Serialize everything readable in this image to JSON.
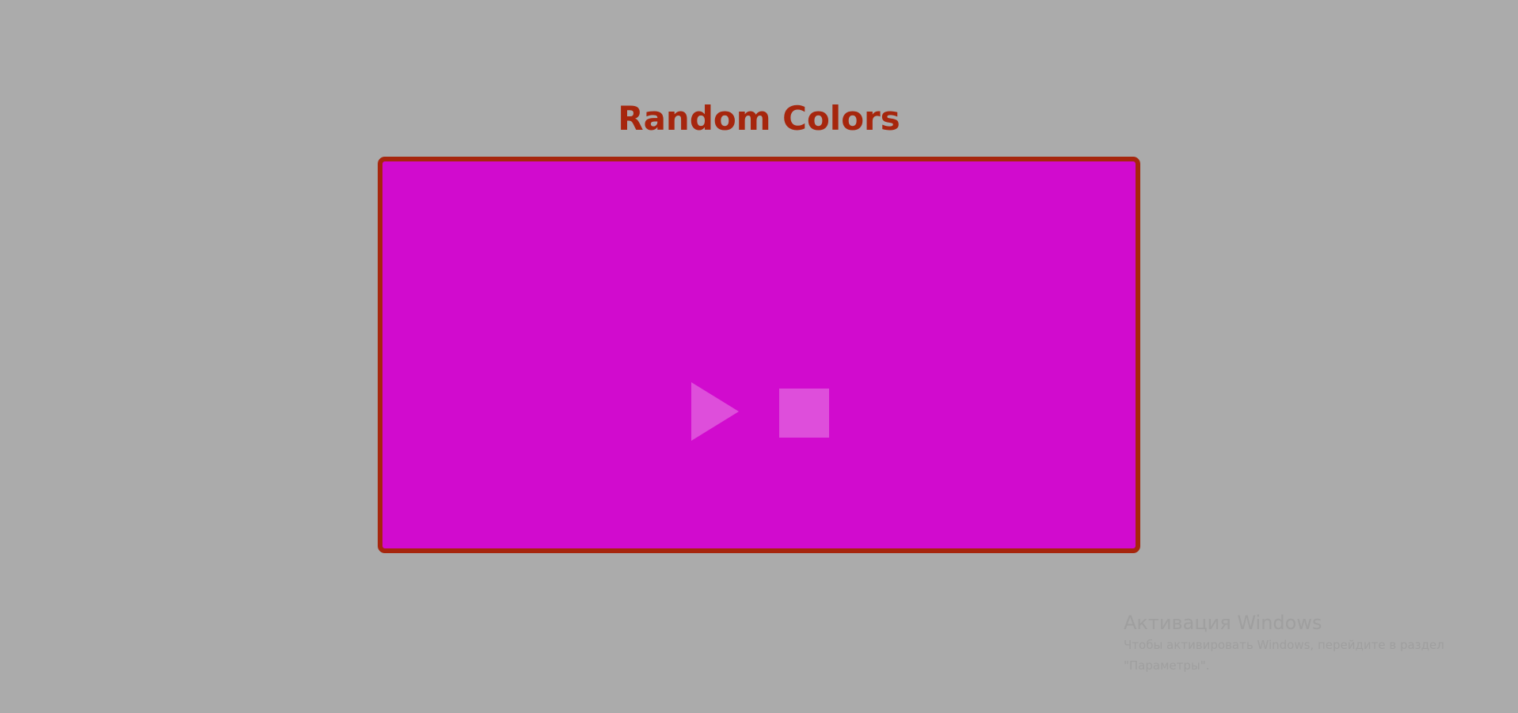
{
  "page": {
    "title": "Random Colors"
  },
  "panel": {
    "current_color": "#d10bce",
    "border_color": "#a6260d"
  },
  "controls": {
    "play_icon": "play-icon",
    "stop_icon": "stop-icon"
  },
  "watermark": {
    "title": "Активация Windows",
    "line1": "Чтобы активировать Windows, перейдите в раздел",
    "line2": "\"Параметры\"."
  },
  "colors": {
    "background": "#ababab",
    "title": "#a6260d"
  }
}
